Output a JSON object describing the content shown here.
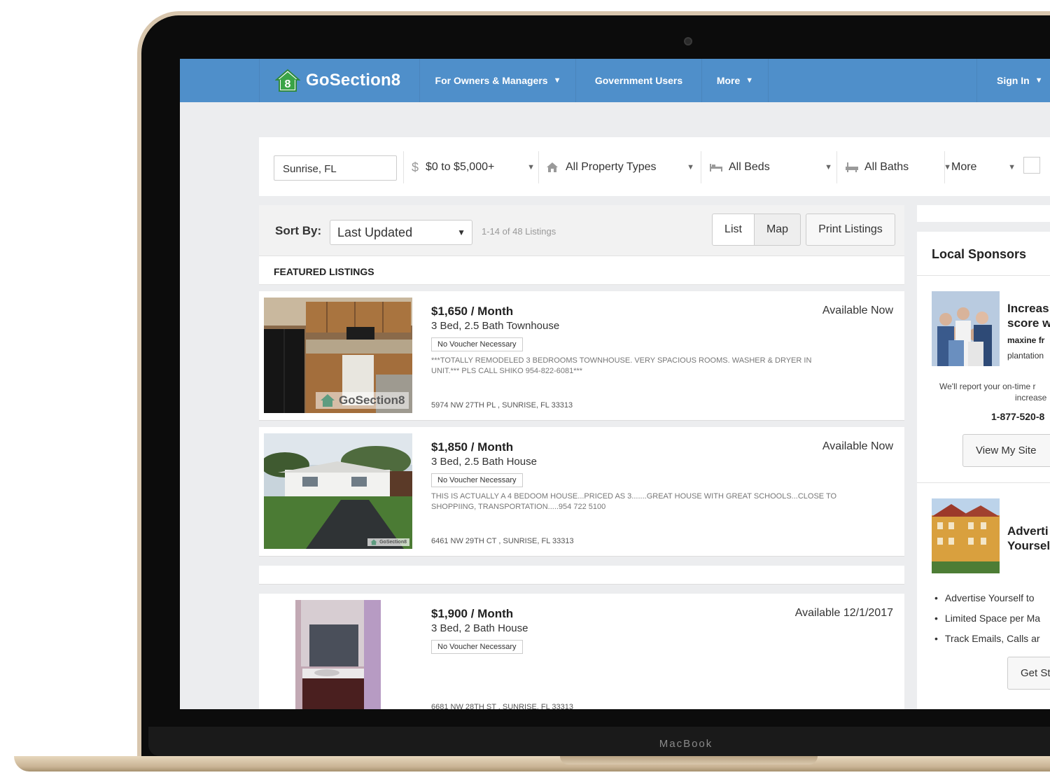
{
  "device": {
    "brand_label": "MacBook"
  },
  "nav": {
    "logo_text": "GoSection8",
    "logo_number": "8",
    "owners_label": "For Owners & Managers",
    "government_label": "Government Users",
    "more_label": "More",
    "signin_label": "Sign In",
    "caret": "▼",
    "brand_color": "#4f8fca"
  },
  "filters": {
    "location_value": "Sunrise, FL",
    "price_label": "$0 to $5,000+",
    "property_type_label": "All Property Types",
    "beds_label": "All Beds",
    "baths_label": "All Baths",
    "more_label": "More",
    "caret": "▼"
  },
  "results": {
    "sort_label": "Sort By:",
    "sort_value": "Last Updated",
    "count_text": "1-14 of 48 Listings",
    "list_label": "List",
    "map_label": "Map",
    "print_label": "Print Listings",
    "featured_heading": "FEATURED LISTINGS"
  },
  "listings": [
    {
      "price": "$1,650 / Month",
      "beds": "3 Bed, 2.5 Bath Townhouse",
      "badge": "No Voucher Necessary",
      "description": "***TOTALLY REMODELED 3 BEDROOMS TOWNHOUSE. VERY SPACIOUS ROOMS. WASHER & DRYER IN UNIT.*** PLS CALL SHIKO 954-822-6081***",
      "address": "5974 NW 27TH PL , SUNRISE, FL 33313",
      "availability": "Available Now",
      "watermark": "GoSection8"
    },
    {
      "price": "$1,850 / Month",
      "beds": "3 Bed, 2.5 Bath House",
      "badge": "No Voucher Necessary",
      "description": "THIS IS ACTUALLY A 4 BEDOOM HOUSE...PRICED AS 3.......GREAT HOUSE WITH GREAT SCHOOLS...CLOSE TO SHOPPIING, TRANSPORTATION.....954 722 5100",
      "address": "6461 NW 29TH CT , SUNRISE, FL 33313",
      "availability": "Available Now",
      "watermark": "GoSection8"
    },
    {
      "price": "$1,900 / Month",
      "beds": "3 Bed, 2 Bath House",
      "badge": "No Voucher Necessary",
      "description": "",
      "address": "6681 NW 28TH ST , SUNRISE, FL 33313",
      "availability": "Available 12/1/2017"
    }
  ],
  "sponsors": {
    "heading": "Local Sponsors",
    "ad1": {
      "title_line1": "Increas",
      "title_line2": "score w",
      "name": "maxine fr",
      "location": "plantation",
      "text_line1": "We'll report your on-time r",
      "text_line2": "increase",
      "phone": "1-877-520-8",
      "button": "View My Site"
    },
    "ad2": {
      "title_line1": "Adverti",
      "title_line2": "Yoursel",
      "bullets": [
        "Advertise Yourself to",
        "Limited Space per Ma",
        "Track Emails, Calls ar"
      ],
      "button": "Get St"
    }
  }
}
